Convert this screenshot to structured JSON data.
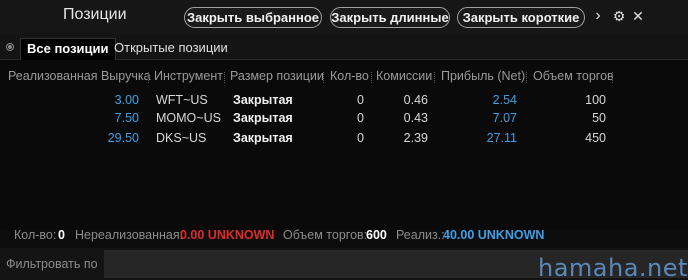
{
  "window": {
    "title": "Позиции",
    "buttons": {
      "close_selected": "Закрыть выбранное",
      "close_long": "Закрыть длинные",
      "close_short": "Закрыть короткие",
      "more": "›",
      "settings": "⚙",
      "close": "✕"
    }
  },
  "tabs": {
    "all": "Все позиции",
    "open": "Открытые позиции"
  },
  "table": {
    "headers": [
      "Реализованная Выручка",
      "Инструмент",
      "Размер позиции",
      "Кол-во",
      "Комиссии",
      "Прибыль (Net)",
      "Объем торгов"
    ],
    "rows": [
      {
        "realized": "3.00",
        "symbol": "WFT~US",
        "size": "Закрытая",
        "qty": "0",
        "commission": "0.46",
        "profit": "2.54",
        "volume": "100"
      },
      {
        "realized": "7.50",
        "symbol": "MOMO~US",
        "size": "Закрытая",
        "qty": "0",
        "commission": "0.43",
        "profit": "7.07",
        "volume": "50"
      },
      {
        "realized": "29.50",
        "symbol": "DKS~US",
        "size": "Закрытая",
        "qty": "0",
        "commission": "2.39",
        "profit": "27.11",
        "volume": "450"
      }
    ]
  },
  "summary": {
    "qty_label": "Кол-во:",
    "qty_value": "0",
    "unrealized_label": "Нереализованная:",
    "unrealized_value": "0.00 UNKNOWN",
    "volume_label": "Объем торгов:",
    "volume_value": "600",
    "realized_label": "Реализ.:",
    "realized_value": "40.00 UNKNOWN"
  },
  "filter": {
    "label": "Фильтровать по",
    "value": ""
  },
  "watermark": "hamaha.net",
  "colors": {
    "accent_blue": "#3da0e6",
    "negative_red": "#e02a2a"
  }
}
